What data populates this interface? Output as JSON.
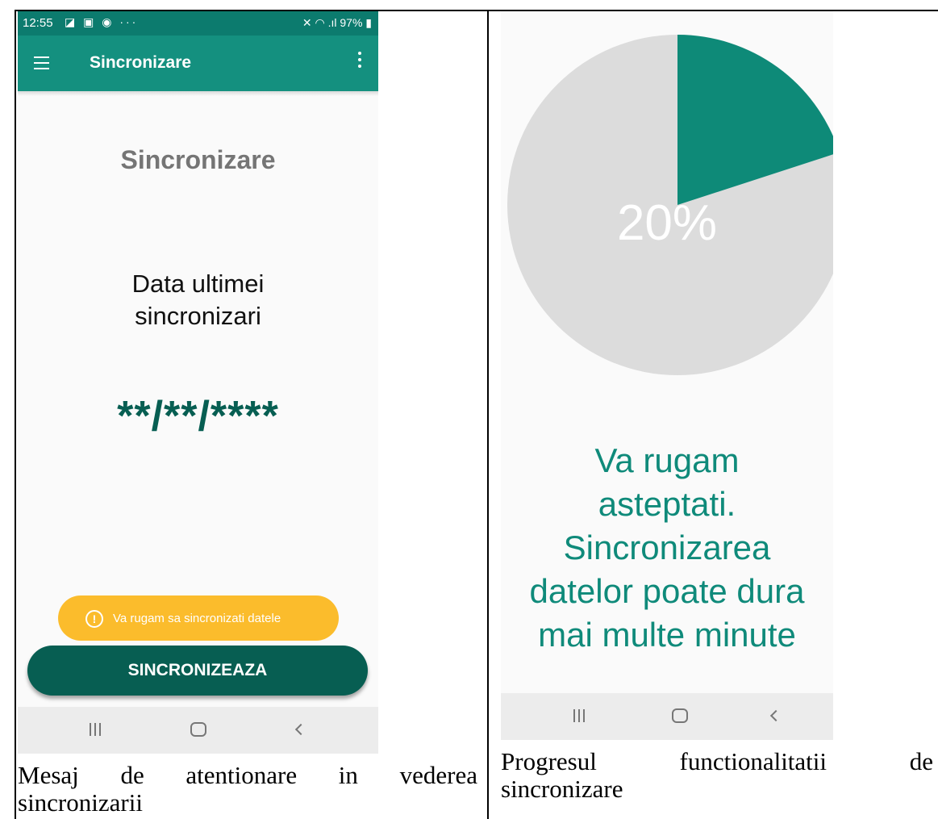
{
  "left_screen": {
    "statusbar": {
      "time": "12:55",
      "left_icons": "◪ ▣ ◉ ···",
      "right_info": "97%"
    },
    "appbar": {
      "title": "Sincronizare",
      "menu_icon": "hamburger-menu-icon",
      "overflow_icon": "more-vert-icon"
    },
    "heading": "Sincronizare",
    "last_sync_label_line1": "Data ultimei",
    "last_sync_label_line2": "sincronizari",
    "last_sync_value": "**/**/****",
    "toast": {
      "icon": "!",
      "text": "Va rugam sa sincronizati datele"
    },
    "sync_button_label": "SINCRONIZEAZA"
  },
  "right_screen": {
    "progress": {
      "value_percent": 20,
      "label": "20%"
    },
    "message_lines": [
      "Va rugam",
      "asteptati.",
      "Sincronizarea",
      "datelor poate dura",
      "mai multe minute"
    ]
  },
  "captions": {
    "left_line1_words": [
      "Mesaj",
      "de",
      "atentionare",
      "in",
      "vederea"
    ],
    "left_line2": "sincronizarii",
    "right_line1_words": [
      "Progresul",
      "functionalitatii",
      "de"
    ],
    "right_line2": "sincronizare"
  },
  "colors": {
    "teal_dark": "#075e52",
    "teal_appbar": "#14907f",
    "teal_text": "#0f8a7a",
    "pie_fill": "#0e8a78",
    "pie_track": "#dcdcdc",
    "toast_bg": "#fbbc2c"
  }
}
